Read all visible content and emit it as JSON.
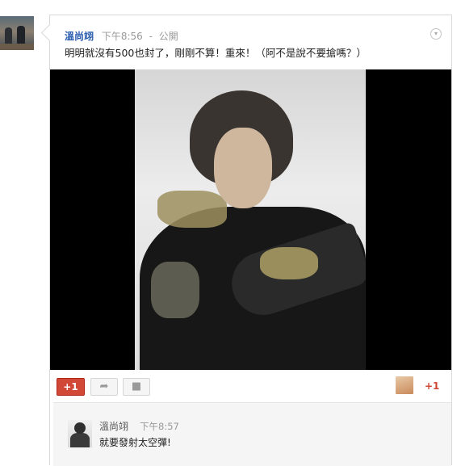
{
  "post": {
    "author": "溫尚翊",
    "timestamp": "下午8:56",
    "separator": "-",
    "visibility": "公開",
    "text": "明明就沒有500也封了，剛剛不算！重來！（阿不是說不要搶嗎？）",
    "menu_icon": "chevron-down-icon"
  },
  "actions": {
    "plus_one_label": "+1",
    "share_icon": "share-arrow-icon",
    "hangout_icon": "video-camera-icon",
    "plus_one_count": "+1"
  },
  "comments": [
    {
      "author": "溫尚翊",
      "timestamp": "下午8:57",
      "text": "就要發射太空彈!"
    }
  ],
  "colors": {
    "author_link": "#2a5db0",
    "plus_one_red": "#d14836",
    "meta_gray": "#999999",
    "comment_bg": "#f5f5f5"
  }
}
